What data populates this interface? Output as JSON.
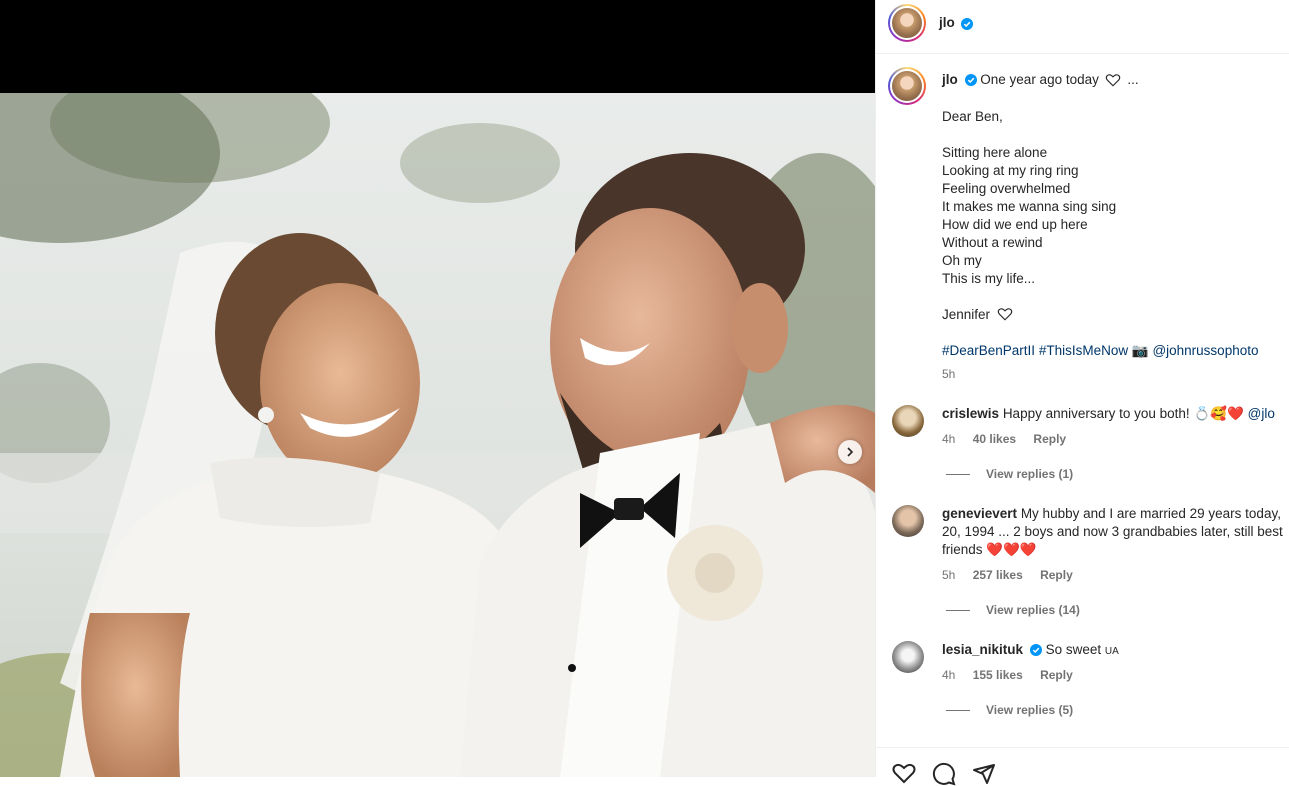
{
  "header": {
    "username": "jlo"
  },
  "caption": {
    "username": "jlo",
    "heading": "One year ago today",
    "lines": [
      "Dear Ben,",
      "",
      "Sitting here alone",
      "Looking at my ring ring",
      "Feeling overwhelmed",
      "It makes me wanna sing sing",
      "How did we end up here",
      "Without a rewind",
      "Oh my",
      "This is my life...",
      "",
      "Jennifer"
    ],
    "hashtag1": "#DearBenPartII",
    "hashtag2": "#ThisIsMeNow",
    "camera_emoji": "📷",
    "mention": "@johnrussophoto",
    "time": "5h"
  },
  "comments": [
    {
      "username": "crislewis",
      "text": "Happy anniversary to you both!",
      "emojis": "💍🥰❤️",
      "mention": "@jlo",
      "time": "4h",
      "likes": "40 likes",
      "reply": "Reply",
      "view_replies": "View replies (1)"
    },
    {
      "username": "genevievert",
      "text": "My hubby and I are married 29 years today, 20, 1994 ... 2 boys and now 3 grandbabies later, still best friends",
      "emojis": "❤️❤️❤️",
      "time": "5h",
      "likes": "257 likes",
      "reply": "Reply",
      "view_replies": "View replies (14)"
    },
    {
      "username": "lesia_nikituk",
      "text": "So sweet",
      "emojis": "UA",
      "time": "4h",
      "likes": "155 likes",
      "reply": "Reply",
      "view_replies": "View replies (5)"
    }
  ],
  "actions": [
    "heart-icon",
    "comment-icon",
    "share-icon"
  ],
  "colors": {
    "verified": "#0095f6",
    "link": "#00376b",
    "muted": "#737373"
  }
}
